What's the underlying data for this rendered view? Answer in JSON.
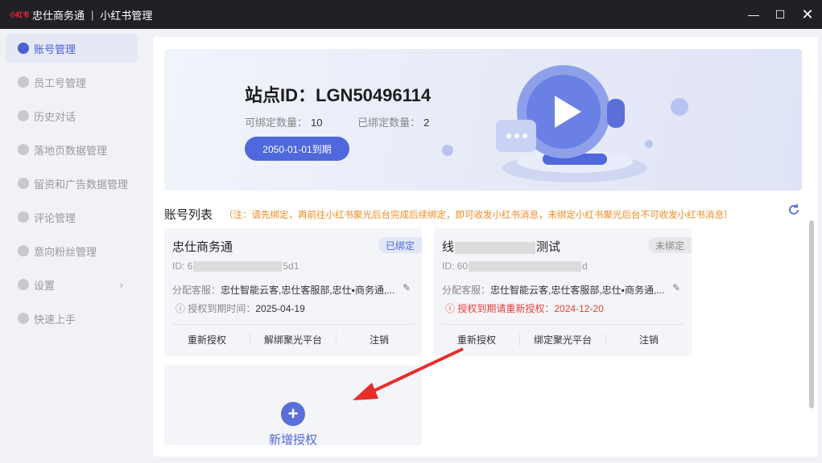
{
  "titlebar": {
    "logo": "小红书",
    "app_name": "忠仕商务通",
    "separator": "|",
    "module": "小红书管理"
  },
  "window": {
    "minimize": "—",
    "maximize": "☐",
    "close": "✕"
  },
  "sidebar": {
    "items": [
      {
        "label": "账号管理",
        "icon": "user-icon",
        "active": true
      },
      {
        "label": "员工号管理",
        "icon": "staff-icon"
      },
      {
        "label": "历史对话",
        "icon": "history-icon"
      },
      {
        "label": "落地页数据管理",
        "icon": "landing-page-icon"
      },
      {
        "label": "留资和广告数据管理",
        "icon": "ad-data-icon"
      },
      {
        "label": "评论管理",
        "icon": "comment-icon"
      },
      {
        "label": "意向粉丝管理",
        "icon": "fans-icon"
      },
      {
        "label": "设置",
        "icon": "gear-icon",
        "chevron": "›"
      },
      {
        "label": "快速上手",
        "icon": "help-icon"
      }
    ]
  },
  "banner": {
    "site_id": "站点ID：LGN50496114",
    "bindable_label": "可绑定数量：",
    "bindable_value": "10",
    "bound_label": "已绑定数量：",
    "bound_value": "2",
    "expire_button": "2050-01-01到期"
  },
  "account_list": {
    "title": "账号列表",
    "note": "（注：请先绑定，再前往小红书聚光后台完成后续绑定，即可收发小红书消息，未绑定小红书聚光后台不可收发小红书消息）",
    "refresh_icon": "refresh-icon"
  },
  "cards": [
    {
      "name": "忠仕商务通",
      "badge": "已绑定",
      "id_prefix": "ID: 6",
      "id_suffix": "5d1",
      "service_label": "分配客服：",
      "service_value": "忠仕智能云客,忠仕客服部,忠仕▪商务通,...",
      "auth_text": "授权到期时间：",
      "auth_date": "2025-04-19",
      "actions": [
        "重新授权",
        "解绑聚光平台",
        "注销"
      ]
    },
    {
      "name_prefix": "线",
      "name_suffix": "测试",
      "badge": "未绑定",
      "id_prefix": "ID: 60",
      "id_suffix": "d",
      "service_label": "分配客服：",
      "service_value": "忠仕智能云客,忠仕客服部,忠仕▪商务通,...",
      "auth_text": "授权到期请重新授权：",
      "auth_date": "2024-12-20",
      "actions": [
        "重新授权",
        "绑定聚光平台",
        "注销"
      ]
    }
  ],
  "add_card": {
    "plus": "+",
    "label": "新增授权"
  },
  "colors": {
    "accent": "#4f68dc",
    "warning": "#f08a24",
    "danger": "#e2413d",
    "titlebar": "#202124"
  }
}
